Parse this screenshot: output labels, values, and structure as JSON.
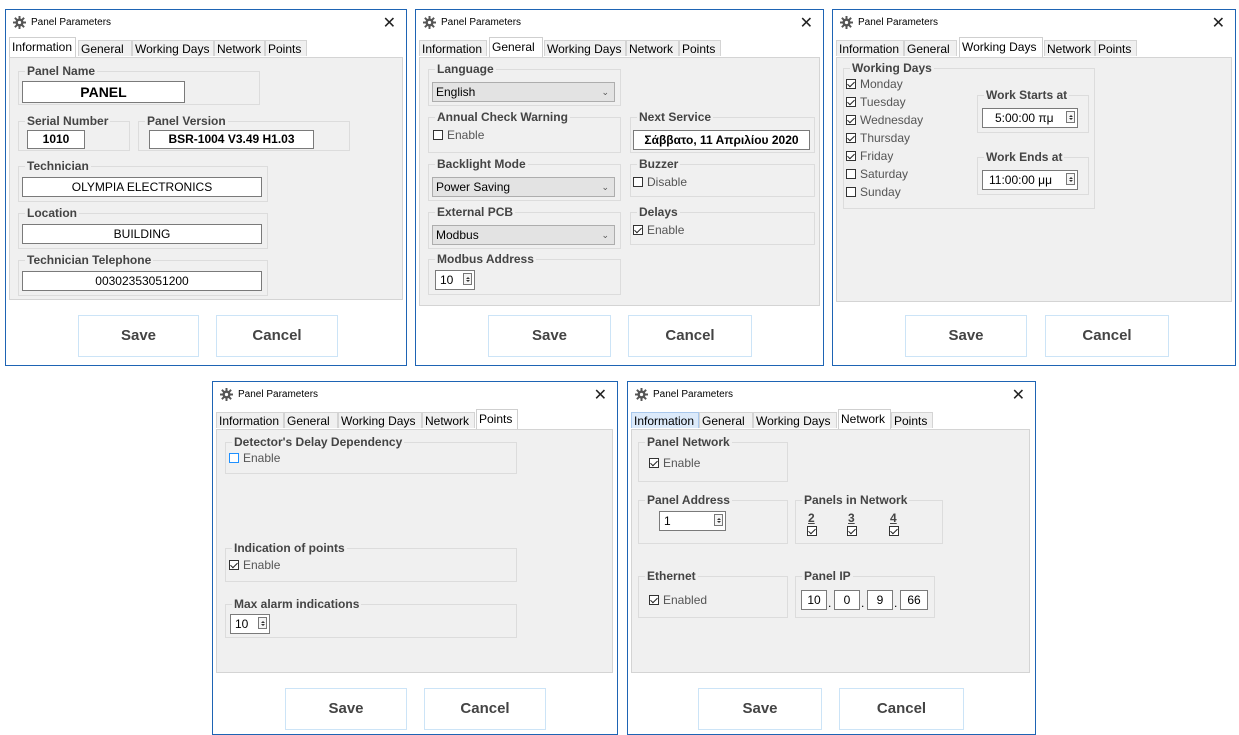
{
  "window_title": "Panel Parameters",
  "tabs": [
    "Information",
    "General",
    "Working Days",
    "Network",
    "Points"
  ],
  "buttons": {
    "save": "Save",
    "cancel": "Cancel"
  },
  "information": {
    "panel_name_label": "Panel Name",
    "panel_name": "PANEL",
    "serial_label": "Serial Number",
    "serial": "1010",
    "version_label": "Panel Version",
    "version": "BSR-1004 V3.49 H1.03",
    "technician_label": "Technician",
    "technician": "OLYMPIA ELECTRONICS",
    "location_label": "Location",
    "location": "BUILDING",
    "telephone_label": "Technician Telephone",
    "telephone": "00302353051200"
  },
  "general": {
    "language_label": "Language",
    "language": "English",
    "annual_label": "Annual Check Warning",
    "annual_cb": "Enable",
    "next_service_label": "Next Service",
    "next_service": "Σάββατο, 11 Απριλίου 2020",
    "backlight_label": "Backlight Mode",
    "backlight": "Power Saving",
    "buzzer_label": "Buzzer",
    "buzzer_cb": "Disable",
    "pcb_label": "External PCB",
    "pcb": "Modbus",
    "delays_label": "Delays",
    "delays_cb": "Enable",
    "modbus_label": "Modbus Address",
    "modbus": "10"
  },
  "working_days": {
    "group_label": "Working Days",
    "days": [
      {
        "name": "Monday",
        "checked": true
      },
      {
        "name": "Tuesday",
        "checked": true
      },
      {
        "name": "Wednesday",
        "checked": true
      },
      {
        "name": "Thursday",
        "checked": true
      },
      {
        "name": "Friday",
        "checked": true
      },
      {
        "name": "Saturday",
        "checked": false
      },
      {
        "name": "Sunday",
        "checked": false
      }
    ],
    "starts_label": "Work Starts at",
    "starts": "5:00:00 πμ",
    "ends_label": "Work Ends at",
    "ends": "11:00:00 μμ"
  },
  "points": {
    "delay_label": "Detector's Delay Dependency",
    "delay_cb": "Enable",
    "indication_label": "Indication of points",
    "indication_cb": "Enable",
    "max_label": "Max alarm indications",
    "max": "10"
  },
  "network": {
    "panel_network_label": "Panel Network",
    "panel_network_cb": "Enable",
    "address_label": "Panel Address",
    "address": "1",
    "panels_label": "Panels in Network",
    "panels": [
      "2",
      "3",
      "4"
    ],
    "ethernet_label": "Ethernet",
    "ethernet_cb": "Enabled",
    "ip_label": "Panel IP",
    "ip": [
      "10",
      "0",
      "9",
      "66"
    ]
  }
}
